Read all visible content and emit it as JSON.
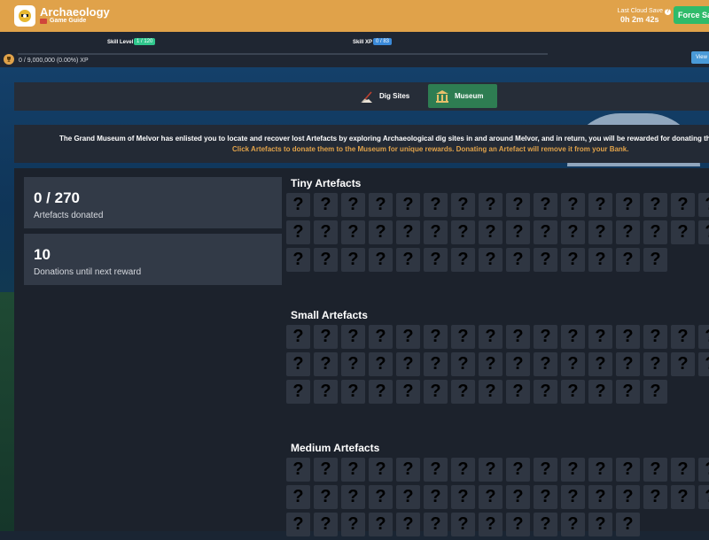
{
  "header": {
    "app_title": "Archaeology",
    "guide_label": "Game Guide",
    "save_label": "Last Cloud Save",
    "save_time": "0h 2m 42s",
    "force_save_label": "Force Sav"
  },
  "skill": {
    "level_label": "Skill Level",
    "level_value": "1 / 120",
    "xp_label": "Skill XP",
    "xp_value": "0 / 83",
    "xp_progress": "0 / 9,000,000 (0.00%) XP",
    "view_label": "View"
  },
  "tabs": [
    {
      "label": "Dig Sites",
      "icon": "shovel-icon",
      "active": false
    },
    {
      "label": "Museum",
      "icon": "museum-icon",
      "active": true
    }
  ],
  "info": {
    "line1": "The Grand Museum of Melvor has enlisted you to locate and recover lost Artefacts by exploring Archaeological dig sites in and around Melvor, and in return, you will be rewarded for donating these Arte",
    "line2": "Click Artefacts to donate them to the Museum for unique rewards. Donating an Artefact will remove it from your Bank."
  },
  "stats": [
    {
      "value": "0 / 270",
      "label": "Artefacts donated"
    },
    {
      "value": "10",
      "label": "Donations until next reward"
    }
  ],
  "sections": [
    {
      "title": "Tiny Artefacts",
      "visible_tiles": 46
    },
    {
      "title": "Small Artefacts",
      "visible_tiles": 46
    },
    {
      "title": "Medium Artefacts",
      "visible_tiles": 45
    }
  ],
  "unknown_tile_glyph": "?",
  "colors": {
    "header": "#e0a24a",
    "active_tab": "#2e7d52",
    "level_badge": "#30c78d",
    "xp_badge": "#3b8ad9",
    "force_save": "#2fbb6a",
    "info_highlight": "#e0a24a"
  }
}
